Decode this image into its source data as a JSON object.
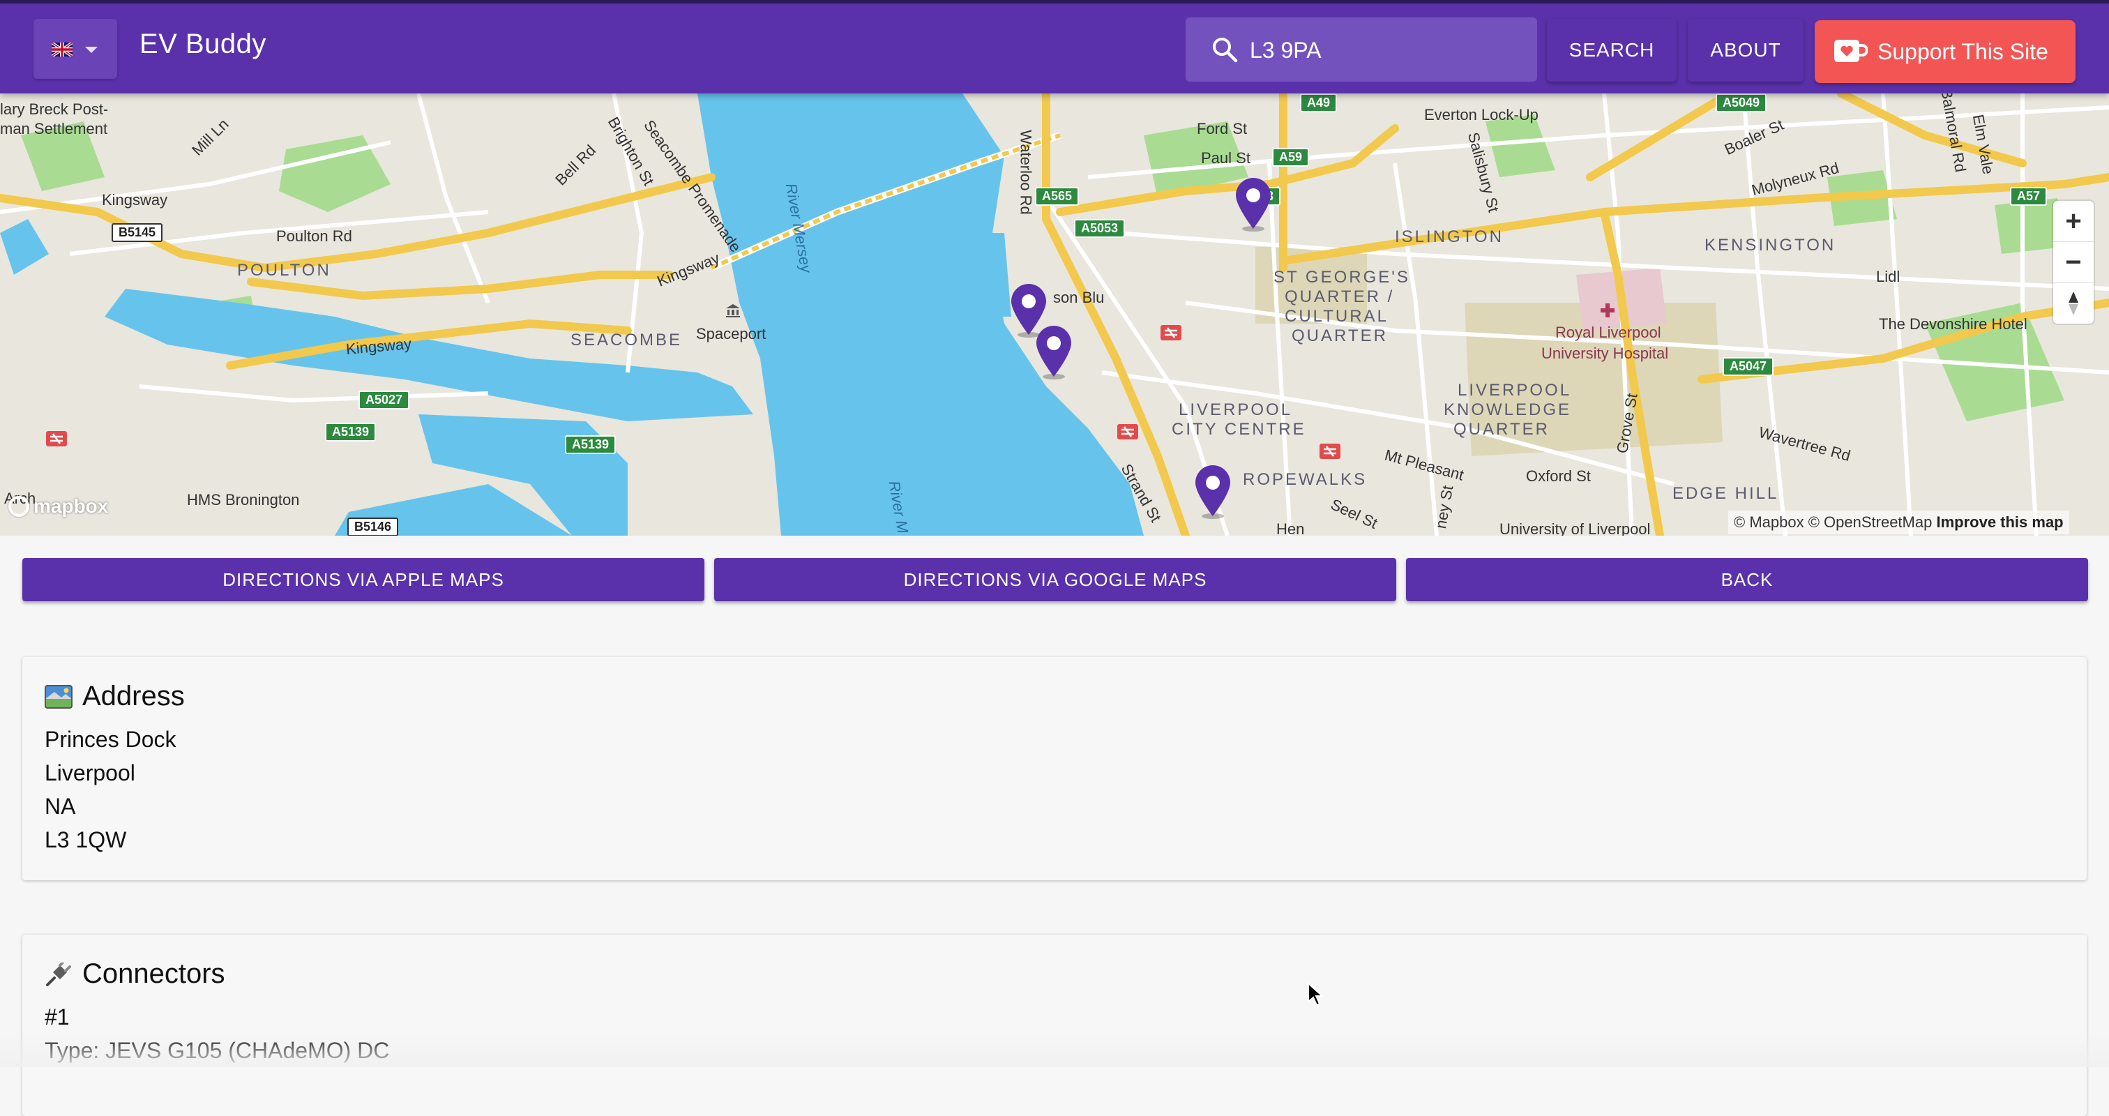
{
  "appbar": {
    "title": "EV Buddy",
    "language_flag": "uk-flag-icon",
    "search_value": "L3 9PA",
    "search_button": "SEARCH",
    "about_button": "ABOUT",
    "support_button": "Support This Site"
  },
  "map": {
    "places": [
      "lary Breck Post-",
      "man Settlement",
      "Mill Ln",
      "Kingsway",
      "Poulton Rd",
      "POULTON",
      "Bell Rd",
      "Brighton St",
      "Seacombe Promenade",
      "Kingsway",
      "SEACOMBE",
      "Spaceport",
      "Kingsway",
      "HMS Bronington",
      "Waterloo Rd",
      "River Mersey",
      "River M",
      "Ford St",
      "Paul St",
      "son Blu",
      "Everton Lock-Up",
      "Salisbury St",
      "Boaler St",
      "Molyneux Rd",
      "Elm Vale",
      "Balmoral Rd",
      "ISLINGTON",
      "KENSINGTON",
      "Lidl",
      "The Devonshire Hotel",
      "Royal Liverpool",
      "University Hospital",
      "ST GEORGE'S",
      "QUARTER /",
      "CULTURAL",
      "QUARTER",
      "LIVERPOOL",
      "CITY CENTRE",
      "LIVERPOOL",
      "KNOWLEDGE",
      "QUARTER",
      "Mt Pleasant",
      "Oxford St",
      "Grove St",
      "Wavertree Rd",
      "EDGE HILL",
      "ROPEWALKS",
      "Strand St",
      "Seel St",
      "University of Liverpool",
      "Hen",
      "ney St",
      "Arch"
    ],
    "shields": [
      "B5145",
      "A5027",
      "A5139",
      "A5139",
      "B5146",
      "A565",
      "A5053",
      "A59",
      "A49",
      "A57",
      "A5049",
      "A5047",
      "3"
    ],
    "zoom_in": "+",
    "zoom_out": "−",
    "compass": "compass-icon",
    "logo": "mapbox",
    "attribution": "© Mapbox © OpenStreetMap",
    "improve": "Improve this map",
    "colors": {
      "water": "#66c4ec",
      "land": "#e9e6de",
      "park": "#a9dc92",
      "major_road": "#f2c94c",
      "pin": "#5a31ab"
    }
  },
  "actions": {
    "apple": "DIRECTIONS VIA APPLE MAPS",
    "google": "DIRECTIONS VIA GOOGLE MAPS",
    "back": "BACK"
  },
  "address": {
    "title": "Address",
    "icon": "map-picture-icon",
    "lines": [
      "Princes Dock",
      "Liverpool",
      "NA",
      "L3 1QW"
    ]
  },
  "connectors": {
    "title": "Connectors",
    "icon": "plug-icon",
    "index": "#1",
    "type": "Type: JEVS G105 (CHAdeMO) DC"
  }
}
